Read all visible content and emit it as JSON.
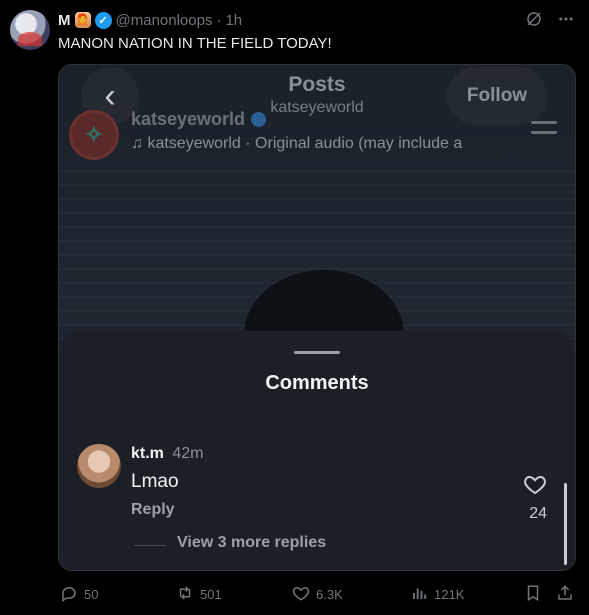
{
  "tweet": {
    "display_name": "M",
    "handle": "@manonloops",
    "separator": "·",
    "time": "1h",
    "text": "MANON NATION IN THE FIELD TODAY!",
    "emoji": "🧑‍🦰"
  },
  "media": {
    "header_title": "Posts",
    "header_subtitle": "katseyeworld",
    "follow_label": "Follow",
    "back_label": "‹",
    "ig_username": "katseyeworld",
    "ig_audio": "♫ katseyeworld · Original audio (may include a"
  },
  "comments_sheet": {
    "title": "Comments",
    "comment": {
      "user": "kt.m",
      "time": "42m",
      "text": "Lmao",
      "reply_label": "Reply",
      "likes": "24"
    },
    "view_more": "View 3 more replies"
  },
  "actions": {
    "replies": "50",
    "reposts": "501",
    "likes": "6.3K",
    "views": "121K"
  },
  "colors": {
    "background": "#000000",
    "verified_blue": "#1d9bf0",
    "muted_text": "#71767b",
    "sheet": "#1c2026"
  },
  "icons": [
    "grok-icon",
    "more-icon",
    "reply-icon",
    "repost-icon",
    "like-icon",
    "views-icon",
    "bookmark-icon",
    "share-icon",
    "heart-icon",
    "back-icon",
    "menu-icon",
    "verified-icon"
  ]
}
